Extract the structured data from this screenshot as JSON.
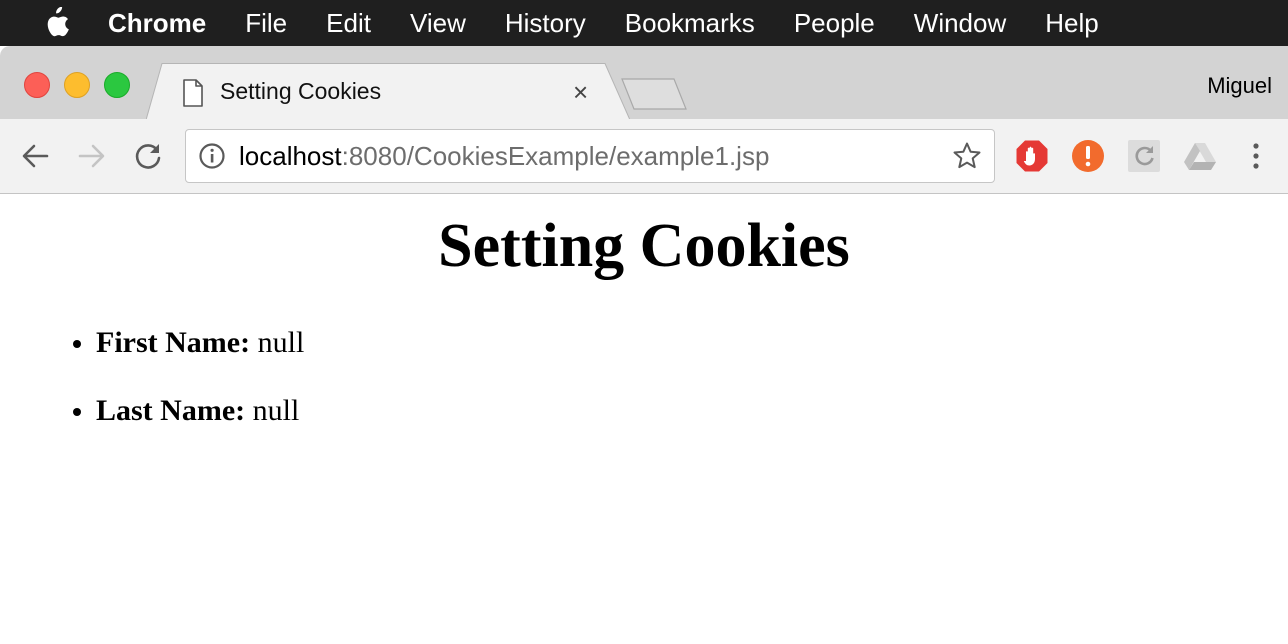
{
  "menubar": {
    "app": "Chrome",
    "items": [
      "File",
      "Edit",
      "View",
      "History",
      "Bookmarks",
      "People",
      "Window",
      "Help"
    ]
  },
  "browser": {
    "tab_title": "Setting Cookies",
    "tab_close": "×",
    "profile": "Miguel",
    "url_host": "localhost",
    "url_rest": ":8080/CookiesExample/example1.jsp",
    "icons": [
      "apple-logo",
      "document-icon",
      "back-arrow",
      "forward-arrow",
      "reload",
      "info",
      "star",
      "adblock",
      "alert",
      "sync",
      "google-drive",
      "more-vert"
    ]
  },
  "page": {
    "title": "Setting Cookies",
    "fields": [
      {
        "label": "First Name:",
        "value": "null"
      },
      {
        "label": "Last Name:",
        "value": "null"
      }
    ]
  },
  "colors": {
    "menubar_bg": "#1f1f1f",
    "tabstrip_bg": "#d3d3d3",
    "toolbar_bg": "#f2f2f2",
    "close": "#fc5f57",
    "minimize": "#fdbd2e",
    "maximize": "#2bc840",
    "adblock": "#e53935",
    "alert": "#f26b2d"
  }
}
